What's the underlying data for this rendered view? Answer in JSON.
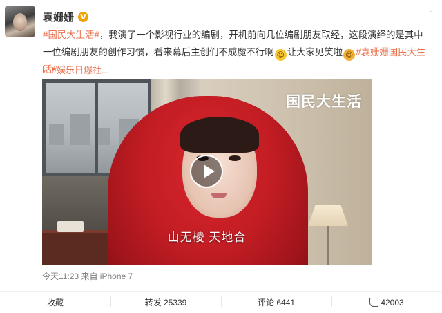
{
  "author": {
    "name": "袁姗姗",
    "verified_badge": "V"
  },
  "post": {
    "hashtag_open": "#国民大生活#",
    "text_1": "，我演了一个影视行业的编剧，开机前向几位编剧朋友取经，这段演绎的是其中一位编剧朋友的创作习惯，看来幕后主创们不成魔不行啊",
    "emoji_1": "laugh-emoji",
    "text_2": "让大家见笑啦",
    "emoji_2": "pray-emoji",
    "hashtag_close": "#袁姗姗国民大生活#"
  },
  "video_link": {
    "label": "娱乐日爆社..."
  },
  "video": {
    "watermark": "国民大生活",
    "subtitle": "山无棱  天地合"
  },
  "meta": {
    "time_source": "今天11:23 来自 iPhone 7"
  },
  "actions": {
    "collect": "收藏",
    "repost": "转发 25339",
    "comment": "评论 6441",
    "like": "42003"
  },
  "colors": {
    "accent": "#eb7350",
    "badge": "#f0a300"
  }
}
